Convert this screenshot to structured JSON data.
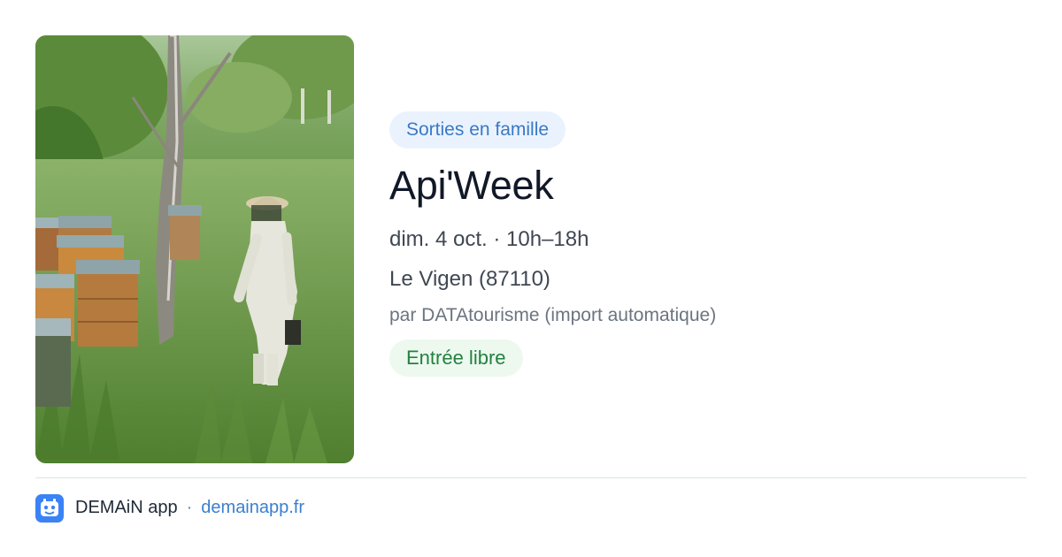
{
  "event": {
    "category": "Sorties en famille",
    "title": "Api'Week",
    "datetime": "dim. 4 oct. · 10h–18h",
    "location": "Le Vigen (87110)",
    "source": "par DATAtourisme (import automatique)",
    "price": "Entrée libre",
    "image_alt": "Beekeeper in protective suit among wooden beehives in a green meadow"
  },
  "footer": {
    "app_name": "DEMAiN app",
    "separator": "·",
    "domain": "demainapp.fr"
  },
  "colors": {
    "accent": "#3a79c7",
    "tag_bg": "#eaf3fd",
    "price_text": "#23823f",
    "price_bg": "#edf8ef",
    "title": "#111827"
  },
  "icons": {
    "app_icon": "demain-app-icon"
  }
}
